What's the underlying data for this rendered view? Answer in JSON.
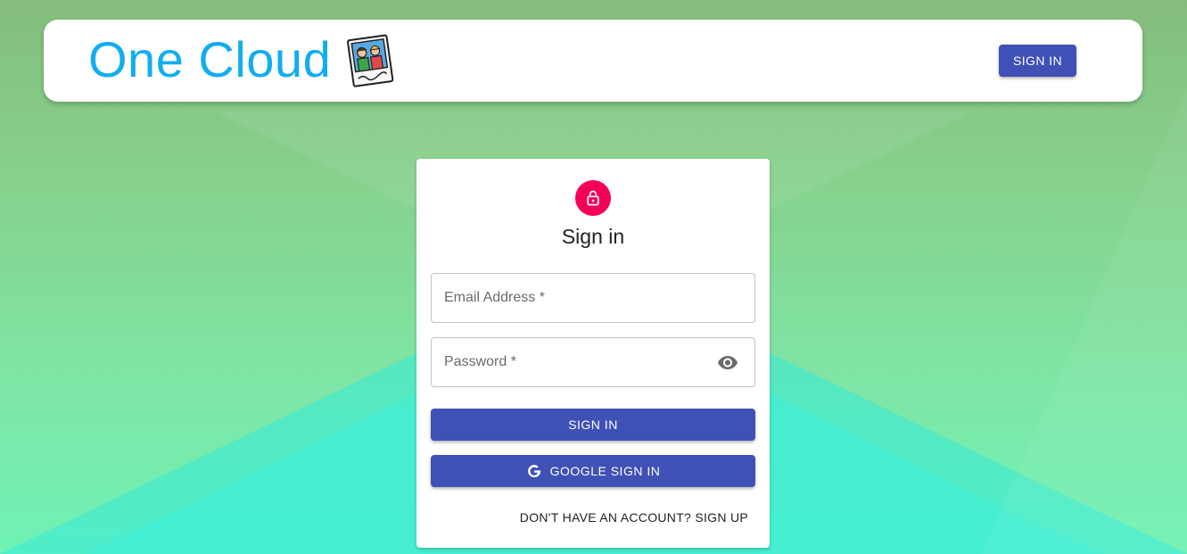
{
  "app": {
    "title": "One Cloud"
  },
  "header": {
    "signin_label": "SIGN IN"
  },
  "login": {
    "title": "Sign in",
    "email_placeholder": "Email Address *",
    "password_placeholder": "Password *",
    "signin_button": "SIGN IN",
    "google_button": "GOOGLE SIGN IN",
    "signup_link": "DON'T HAVE AN ACCOUNT? SIGN UP"
  },
  "icons": {
    "brand_logo": "photo-frame-icon",
    "avatar": "lock-icon",
    "password_toggle": "eye-icon",
    "google": "google-g-icon"
  },
  "colors": {
    "brand_text": "#11adf0",
    "primary": "#3f51b5",
    "avatar_bg": "#f50057",
    "background_top": "#85bd7c",
    "background_bottom": "#6ff2b5"
  }
}
